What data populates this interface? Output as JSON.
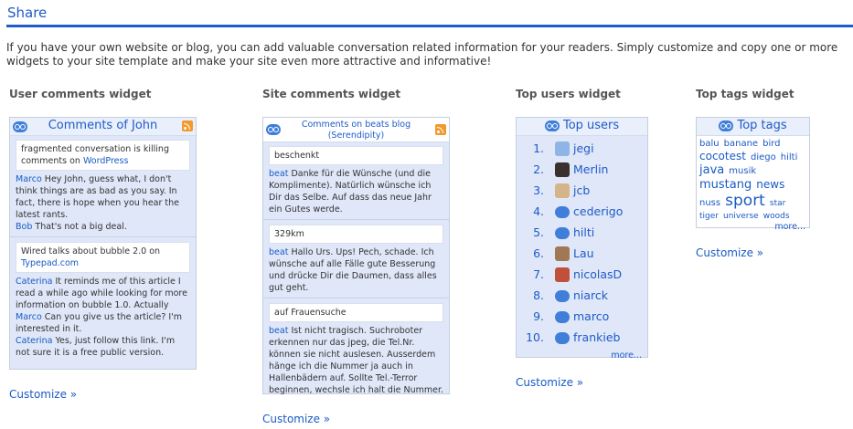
{
  "page": {
    "title": "Share",
    "intro": "If you have your own website or blog, you can add valuable conversation related information for your readers. Simply customize and copy one or more widgets to your site template and make your site even more attractive and informative!"
  },
  "user_comments": {
    "heading": "User comments widget",
    "widget_title": "Comments of John",
    "threads": [
      {
        "topic_text": "fragmented conversation is killing comments on",
        "topic_link": "WordPress",
        "comments": [
          {
            "author": "Marco",
            "text": "Hey John, guess what, I don't think things are as bad as you say. In fact, there is hope when you hear the latest rants."
          },
          {
            "author": "Bob",
            "text": "That's not a big deal."
          }
        ]
      },
      {
        "topic_text": "Wired talks about bubble 2.0 on",
        "topic_link": "Typepad.com",
        "comments": [
          {
            "author": "Caterina",
            "text": "It reminds me of this article I read a while ago while looking for more information on bubble 1.0. Actually"
          },
          {
            "author": "Marco",
            "text": "Can you give us the article? I'm interested in it."
          },
          {
            "author": "Caterina",
            "text": "Yes, just follow this link. I'm not sure it is a free public version."
          }
        ]
      }
    ],
    "customize": "Customize »"
  },
  "site_comments": {
    "heading": "Site comments widget",
    "widget_title": "Comments on beats blog (Serendipity)",
    "threads": [
      {
        "topic": "beschenkt",
        "author": "beat",
        "text": "Danke für die Wünsche (und die Komplimente). Natürlich wünsche ich Dir das Selbe. Auf dass das neue Jahr ein Gutes werde."
      },
      {
        "topic": "329km",
        "author": "beat",
        "text": "Hallo Urs. Ups! Pech, schade. Ich wünsche auf alle Fälle gute Besserung und drücke Dir die Daumen, dass alles gut geht."
      },
      {
        "topic": "auf Frauensuche",
        "author": "beat",
        "text": "Ist nicht tragisch. Suchroboter erkennen nur das jpeg, die Tel.Nr. können sie nicht auslesen. Ausserdem hänge ich die Nummer ja auch in Hallenbädern auf. Sollte Tel.-Terror beginnen, wechsle ich halt die Nummer."
      }
    ],
    "customize": "Customize »"
  },
  "top_users": {
    "heading": "Top users widget",
    "widget_title": "Top users",
    "users": [
      {
        "rank": "1.",
        "name": "jegi",
        "avatar_icon": "person-avatar-icon",
        "avatar_color": "#8fb4e8"
      },
      {
        "rank": "2.",
        "name": "Merlin",
        "avatar_icon": "photo-avatar-icon",
        "avatar_color": "#3a3030"
      },
      {
        "rank": "3.",
        "name": "jcb",
        "avatar_icon": "photo-avatar-icon",
        "avatar_color": "#d6b48a"
      },
      {
        "rank": "4.",
        "name": "cederigo",
        "avatar_icon": "cocomment-logo-icon",
        "avatar_color": "#3f7fd9"
      },
      {
        "rank": "5.",
        "name": "hilti",
        "avatar_icon": "cocomment-logo-icon",
        "avatar_color": "#3f7fd9"
      },
      {
        "rank": "6.",
        "name": "Lau",
        "avatar_icon": "photo-avatar-icon",
        "avatar_color": "#a07855"
      },
      {
        "rank": "7.",
        "name": "nicolasD",
        "avatar_icon": "photo-avatar-icon",
        "avatar_color": "#c0503a"
      },
      {
        "rank": "8.",
        "name": "niarck",
        "avatar_icon": "cocomment-logo-icon",
        "avatar_color": "#3f7fd9"
      },
      {
        "rank": "9.",
        "name": "marco",
        "avatar_icon": "cocomment-logo-icon",
        "avatar_color": "#3f7fd9"
      },
      {
        "rank": "10.",
        "name": "frankieb",
        "avatar_icon": "cocomment-logo-icon",
        "avatar_color": "#3f7fd9"
      }
    ],
    "more": "more...",
    "customize": "Customize »"
  },
  "top_tags": {
    "heading": "Top tags widget",
    "widget_title": "Top tags",
    "tags": [
      {
        "name": "balu",
        "size": 10
      },
      {
        "name": "banane",
        "size": 10
      },
      {
        "name": "bird",
        "size": 10
      },
      {
        "name": "cocotest",
        "size": 12
      },
      {
        "name": "diego",
        "size": 10
      },
      {
        "name": "hilti",
        "size": 10
      },
      {
        "name": "java",
        "size": 13
      },
      {
        "name": "musik",
        "size": 10
      },
      {
        "name": "mustang",
        "size": 13
      },
      {
        "name": "news",
        "size": 12
      },
      {
        "name": "nuss",
        "size": 10
      },
      {
        "name": "sport",
        "size": 17
      },
      {
        "name": "star",
        "size": 9
      },
      {
        "name": "tiger",
        "size": 9
      },
      {
        "name": "universe",
        "size": 9
      },
      {
        "name": "woods",
        "size": 9
      }
    ],
    "more": "more...",
    "customize": "Customize »"
  },
  "colors": {
    "accent": "#1f5bc9",
    "widget_bg": "#dfe7f8",
    "rss": "#f39a2b"
  }
}
